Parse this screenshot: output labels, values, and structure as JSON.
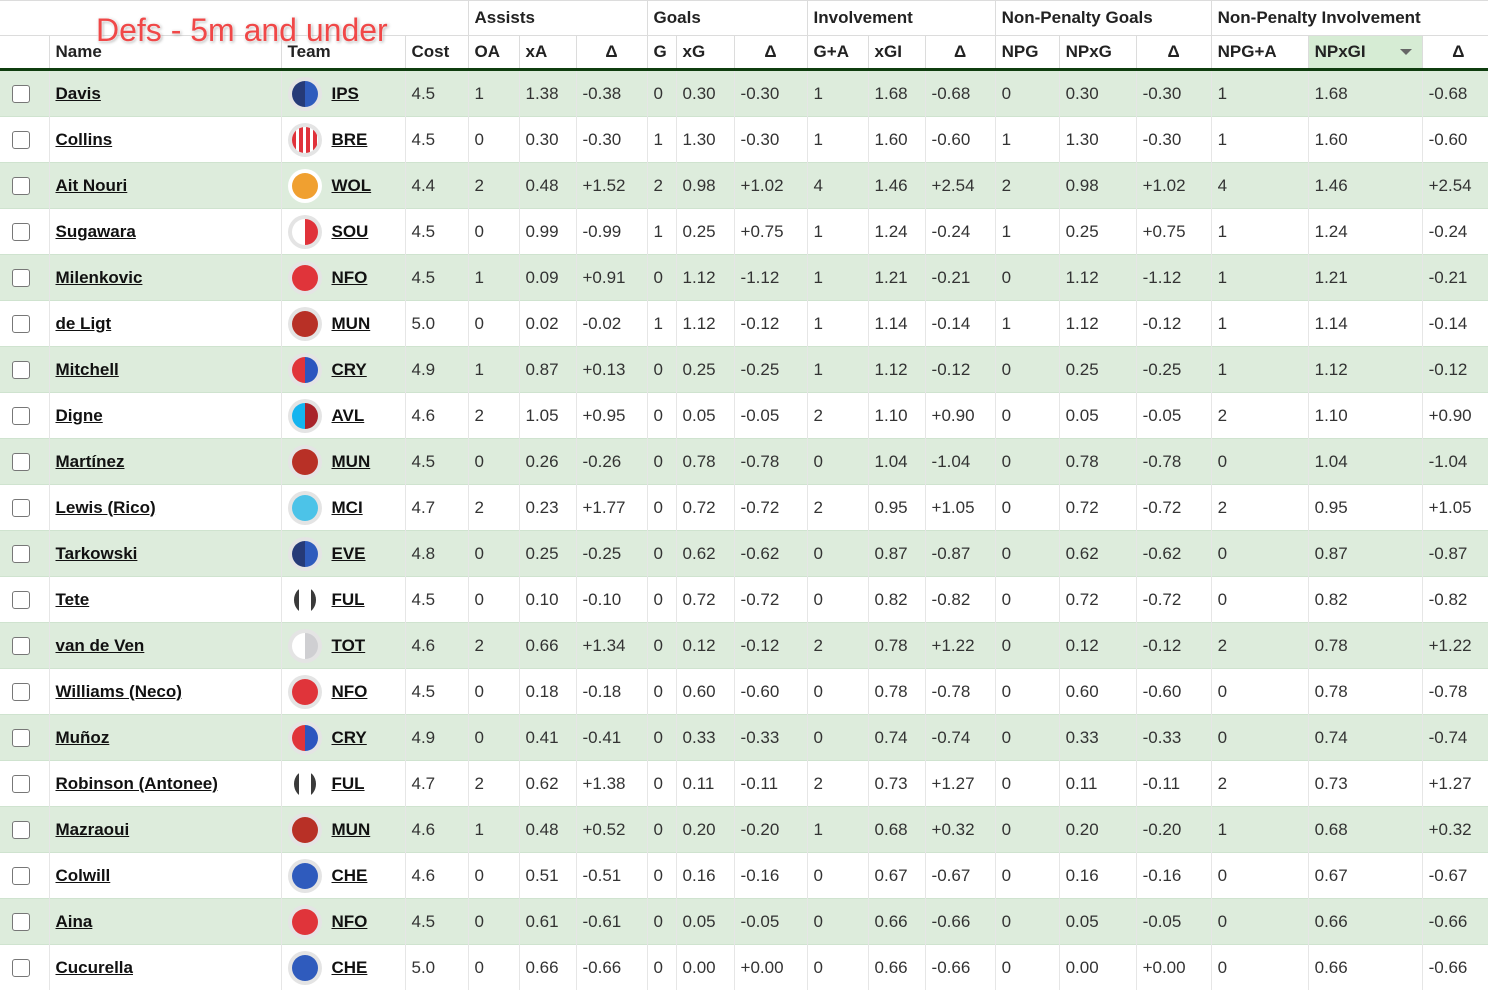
{
  "overlay_title": "Defs - 5m and under",
  "header": {
    "groups": [
      "Assists",
      "Goals",
      "Involvement",
      "Non-Penalty Goals",
      "Non-Penalty Involvement"
    ],
    "columns": {
      "name": "Name",
      "team": "Team",
      "cost": "Cost",
      "oa": "OA",
      "xa": "xA",
      "d_assists": "Δ",
      "g": "G",
      "xg": "xG",
      "d_goals": "Δ",
      "ga": "G+A",
      "xgi": "xGI",
      "d_inv": "Δ",
      "npg": "NPG",
      "npxg": "NPxG",
      "d_npg": "Δ",
      "npga": "NPG+A",
      "npxgi": "NPxGI",
      "d_npi": "Δ"
    },
    "sorted_column": "NPxGI",
    "sort_direction": "descending"
  },
  "teams": {
    "IPS": {
      "style": "half",
      "left": "#263a78",
      "right": "#2f5bbd",
      "ring": "grey"
    },
    "BRE": {
      "style": "stripes",
      "left": "#e0323a",
      "right": "#ffffff",
      "ring": "grey"
    },
    "WOL": {
      "style": "solid",
      "left": "#f0a030",
      "ring": "white"
    },
    "SOU": {
      "style": "half",
      "left": "#ffffff",
      "right": "#e0323a",
      "ring": "grey"
    },
    "NFO": {
      "style": "solid",
      "left": "#e0343a",
      "ring": "grey"
    },
    "MUN": {
      "style": "solid",
      "left": "#b83026",
      "ring": "grey"
    },
    "CRY": {
      "style": "half",
      "left": "#e0343a",
      "right": "#2c55bf",
      "ring": "grey"
    },
    "AVL": {
      "style": "half",
      "left": "#14b4ef",
      "right": "#a8232a",
      "ring": "grey"
    },
    "MCI": {
      "style": "solid",
      "left": "#4cc3e8",
      "ring": "grey"
    },
    "EVE": {
      "style": "half",
      "left": "#263a78",
      "right": "#2f5bbd",
      "ring": "grey"
    },
    "FUL": {
      "style": "brackets",
      "left": "#3a3a3a",
      "right": "#ffffff",
      "ring": "none"
    },
    "TOT": {
      "style": "half",
      "left": "#ffffff",
      "right": "#cfcfd2",
      "ring": "grey"
    },
    "CHE": {
      "style": "solid",
      "left": "#2f5bbd",
      "ring": "grey"
    }
  },
  "rows": [
    {
      "name": "Davis",
      "team": "IPS",
      "cost": "4.5",
      "oa": "1",
      "xa": "1.38",
      "d_assists": "-0.38",
      "g": "0",
      "xg": "0.30",
      "d_goals": "-0.30",
      "ga": "1",
      "xgi": "1.68",
      "d_inv": "-0.68",
      "npg": "0",
      "npxg": "0.30",
      "d_npg": "-0.30",
      "npga": "1",
      "npxgi": "1.68",
      "d_npi": "-0.68"
    },
    {
      "name": "Collins",
      "team": "BRE",
      "cost": "4.5",
      "oa": "0",
      "xa": "0.30",
      "d_assists": "-0.30",
      "g": "1",
      "xg": "1.30",
      "d_goals": "-0.30",
      "ga": "1",
      "xgi": "1.60",
      "d_inv": "-0.60",
      "npg": "1",
      "npxg": "1.30",
      "d_npg": "-0.30",
      "npga": "1",
      "npxgi": "1.60",
      "d_npi": "-0.60"
    },
    {
      "name": "Ait Nouri",
      "team": "WOL",
      "cost": "4.4",
      "oa": "2",
      "xa": "0.48",
      "d_assists": "+1.52",
      "g": "2",
      "xg": "0.98",
      "d_goals": "+1.02",
      "ga": "4",
      "xgi": "1.46",
      "d_inv": "+2.54",
      "npg": "2",
      "npxg": "0.98",
      "d_npg": "+1.02",
      "npga": "4",
      "npxgi": "1.46",
      "d_npi": "+2.54"
    },
    {
      "name": "Sugawara",
      "team": "SOU",
      "cost": "4.5",
      "oa": "0",
      "xa": "0.99",
      "d_assists": "-0.99",
      "g": "1",
      "xg": "0.25",
      "d_goals": "+0.75",
      "ga": "1",
      "xgi": "1.24",
      "d_inv": "-0.24",
      "npg": "1",
      "npxg": "0.25",
      "d_npg": "+0.75",
      "npga": "1",
      "npxgi": "1.24",
      "d_npi": "-0.24"
    },
    {
      "name": "Milenkovic",
      "team": "NFO",
      "cost": "4.5",
      "oa": "1",
      "xa": "0.09",
      "d_assists": "+0.91",
      "g": "0",
      "xg": "1.12",
      "d_goals": "-1.12",
      "ga": "1",
      "xgi": "1.21",
      "d_inv": "-0.21",
      "npg": "0",
      "npxg": "1.12",
      "d_npg": "-1.12",
      "npga": "1",
      "npxgi": "1.21",
      "d_npi": "-0.21"
    },
    {
      "name": "de Ligt",
      "team": "MUN",
      "cost": "5.0",
      "oa": "0",
      "xa": "0.02",
      "d_assists": "-0.02",
      "g": "1",
      "xg": "1.12",
      "d_goals": "-0.12",
      "ga": "1",
      "xgi": "1.14",
      "d_inv": "-0.14",
      "npg": "1",
      "npxg": "1.12",
      "d_npg": "-0.12",
      "npga": "1",
      "npxgi": "1.14",
      "d_npi": "-0.14"
    },
    {
      "name": "Mitchell",
      "team": "CRY",
      "cost": "4.9",
      "oa": "1",
      "xa": "0.87",
      "d_assists": "+0.13",
      "g": "0",
      "xg": "0.25",
      "d_goals": "-0.25",
      "ga": "1",
      "xgi": "1.12",
      "d_inv": "-0.12",
      "npg": "0",
      "npxg": "0.25",
      "d_npg": "-0.25",
      "npga": "1",
      "npxgi": "1.12",
      "d_npi": "-0.12"
    },
    {
      "name": "Digne",
      "team": "AVL",
      "cost": "4.6",
      "oa": "2",
      "xa": "1.05",
      "d_assists": "+0.95",
      "g": "0",
      "xg": "0.05",
      "d_goals": "-0.05",
      "ga": "2",
      "xgi": "1.10",
      "d_inv": "+0.90",
      "npg": "0",
      "npxg": "0.05",
      "d_npg": "-0.05",
      "npga": "2",
      "npxgi": "1.10",
      "d_npi": "+0.90"
    },
    {
      "name": "Martínez",
      "team": "MUN",
      "cost": "4.5",
      "oa": "0",
      "xa": "0.26",
      "d_assists": "-0.26",
      "g": "0",
      "xg": "0.78",
      "d_goals": "-0.78",
      "ga": "0",
      "xgi": "1.04",
      "d_inv": "-1.04",
      "npg": "0",
      "npxg": "0.78",
      "d_npg": "-0.78",
      "npga": "0",
      "npxgi": "1.04",
      "d_npi": "-1.04"
    },
    {
      "name": "Lewis (Rico)",
      "team": "MCI",
      "cost": "4.7",
      "oa": "2",
      "xa": "0.23",
      "d_assists": "+1.77",
      "g": "0",
      "xg": "0.72",
      "d_goals": "-0.72",
      "ga": "2",
      "xgi": "0.95",
      "d_inv": "+1.05",
      "npg": "0",
      "npxg": "0.72",
      "d_npg": "-0.72",
      "npga": "2",
      "npxgi": "0.95",
      "d_npi": "+1.05"
    },
    {
      "name": "Tarkowski",
      "team": "EVE",
      "cost": "4.8",
      "oa": "0",
      "xa": "0.25",
      "d_assists": "-0.25",
      "g": "0",
      "xg": "0.62",
      "d_goals": "-0.62",
      "ga": "0",
      "xgi": "0.87",
      "d_inv": "-0.87",
      "npg": "0",
      "npxg": "0.62",
      "d_npg": "-0.62",
      "npga": "0",
      "npxgi": "0.87",
      "d_npi": "-0.87"
    },
    {
      "name": "Tete",
      "team": "FUL",
      "cost": "4.5",
      "oa": "0",
      "xa": "0.10",
      "d_assists": "-0.10",
      "g": "0",
      "xg": "0.72",
      "d_goals": "-0.72",
      "ga": "0",
      "xgi": "0.82",
      "d_inv": "-0.82",
      "npg": "0",
      "npxg": "0.72",
      "d_npg": "-0.72",
      "npga": "0",
      "npxgi": "0.82",
      "d_npi": "-0.82"
    },
    {
      "name": "van de Ven",
      "team": "TOT",
      "cost": "4.6",
      "oa": "2",
      "xa": "0.66",
      "d_assists": "+1.34",
      "g": "0",
      "xg": "0.12",
      "d_goals": "-0.12",
      "ga": "2",
      "xgi": "0.78",
      "d_inv": "+1.22",
      "npg": "0",
      "npxg": "0.12",
      "d_npg": "-0.12",
      "npga": "2",
      "npxgi": "0.78",
      "d_npi": "+1.22"
    },
    {
      "name": "Williams (Neco)",
      "team": "NFO",
      "cost": "4.5",
      "oa": "0",
      "xa": "0.18",
      "d_assists": "-0.18",
      "g": "0",
      "xg": "0.60",
      "d_goals": "-0.60",
      "ga": "0",
      "xgi": "0.78",
      "d_inv": "-0.78",
      "npg": "0",
      "npxg": "0.60",
      "d_npg": "-0.60",
      "npga": "0",
      "npxgi": "0.78",
      "d_npi": "-0.78"
    },
    {
      "name": "Muñoz",
      "team": "CRY",
      "cost": "4.9",
      "oa": "0",
      "xa": "0.41",
      "d_assists": "-0.41",
      "g": "0",
      "xg": "0.33",
      "d_goals": "-0.33",
      "ga": "0",
      "xgi": "0.74",
      "d_inv": "-0.74",
      "npg": "0",
      "npxg": "0.33",
      "d_npg": "-0.33",
      "npga": "0",
      "npxgi": "0.74",
      "d_npi": "-0.74"
    },
    {
      "name": "Robinson (Antonee)",
      "team": "FUL",
      "cost": "4.7",
      "oa": "2",
      "xa": "0.62",
      "d_assists": "+1.38",
      "g": "0",
      "xg": "0.11",
      "d_goals": "-0.11",
      "ga": "2",
      "xgi": "0.73",
      "d_inv": "+1.27",
      "npg": "0",
      "npxg": "0.11",
      "d_npg": "-0.11",
      "npga": "2",
      "npxgi": "0.73",
      "d_npi": "+1.27"
    },
    {
      "name": "Mazraoui",
      "team": "MUN",
      "cost": "4.6",
      "oa": "1",
      "xa": "0.48",
      "d_assists": "+0.52",
      "g": "0",
      "xg": "0.20",
      "d_goals": "-0.20",
      "ga": "1",
      "xgi": "0.68",
      "d_inv": "+0.32",
      "npg": "0",
      "npxg": "0.20",
      "d_npg": "-0.20",
      "npga": "1",
      "npxgi": "0.68",
      "d_npi": "+0.32"
    },
    {
      "name": "Colwill",
      "team": "CHE",
      "cost": "4.6",
      "oa": "0",
      "xa": "0.51",
      "d_assists": "-0.51",
      "g": "0",
      "xg": "0.16",
      "d_goals": "-0.16",
      "ga": "0",
      "xgi": "0.67",
      "d_inv": "-0.67",
      "npg": "0",
      "npxg": "0.16",
      "d_npg": "-0.16",
      "npga": "0",
      "npxgi": "0.67",
      "d_npi": "-0.67"
    },
    {
      "name": "Aina",
      "team": "NFO",
      "cost": "4.5",
      "oa": "0",
      "xa": "0.61",
      "d_assists": "-0.61",
      "g": "0",
      "xg": "0.05",
      "d_goals": "-0.05",
      "ga": "0",
      "xgi": "0.66",
      "d_inv": "-0.66",
      "npg": "0",
      "npxg": "0.05",
      "d_npg": "-0.05",
      "npga": "0",
      "npxgi": "0.66",
      "d_npi": "-0.66"
    },
    {
      "name": "Cucurella",
      "team": "CHE",
      "cost": "5.0",
      "oa": "0",
      "xa": "0.66",
      "d_assists": "-0.66",
      "g": "0",
      "xg": "0.00",
      "d_goals": "+0.00",
      "ga": "0",
      "xgi": "0.66",
      "d_inv": "-0.66",
      "npg": "0",
      "npxg": "0.00",
      "d_npg": "+0.00",
      "npga": "0",
      "npxgi": "0.66",
      "d_npi": "-0.66"
    }
  ]
}
